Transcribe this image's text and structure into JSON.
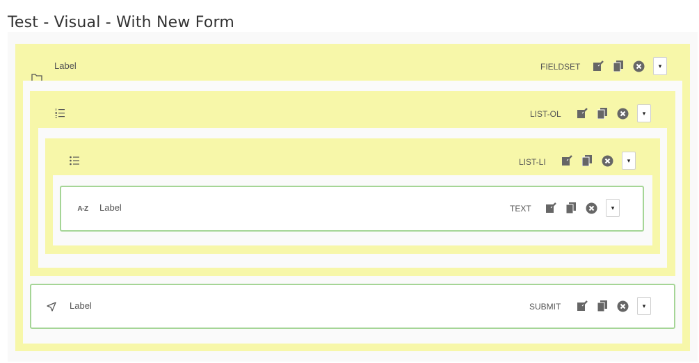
{
  "page": {
    "title": "Test - Visual - With New Form"
  },
  "fieldset": {
    "label": "Label",
    "type": "FIELDSET",
    "icon": "folder-icon"
  },
  "list_ol": {
    "type": "LIST-OL",
    "icon": "ordered-list-icon"
  },
  "list_li": {
    "type": "LIST-LI",
    "icon": "unordered-list-icon"
  },
  "text": {
    "label": "Label",
    "type": "TEXT",
    "icon_text": "A-Z"
  },
  "submit": {
    "label": "Label",
    "type": "SUBMIT",
    "icon": "send-icon"
  },
  "toolbar": {
    "dropdown_glyph": "▾",
    "edit_icon": "edit-icon",
    "copy_icon": "copy-icon",
    "delete_icon": "delete-icon"
  },
  "colors": {
    "container": "#f7f7a9",
    "field_border": "#a5d596",
    "canvas": "#f9f9f9"
  }
}
